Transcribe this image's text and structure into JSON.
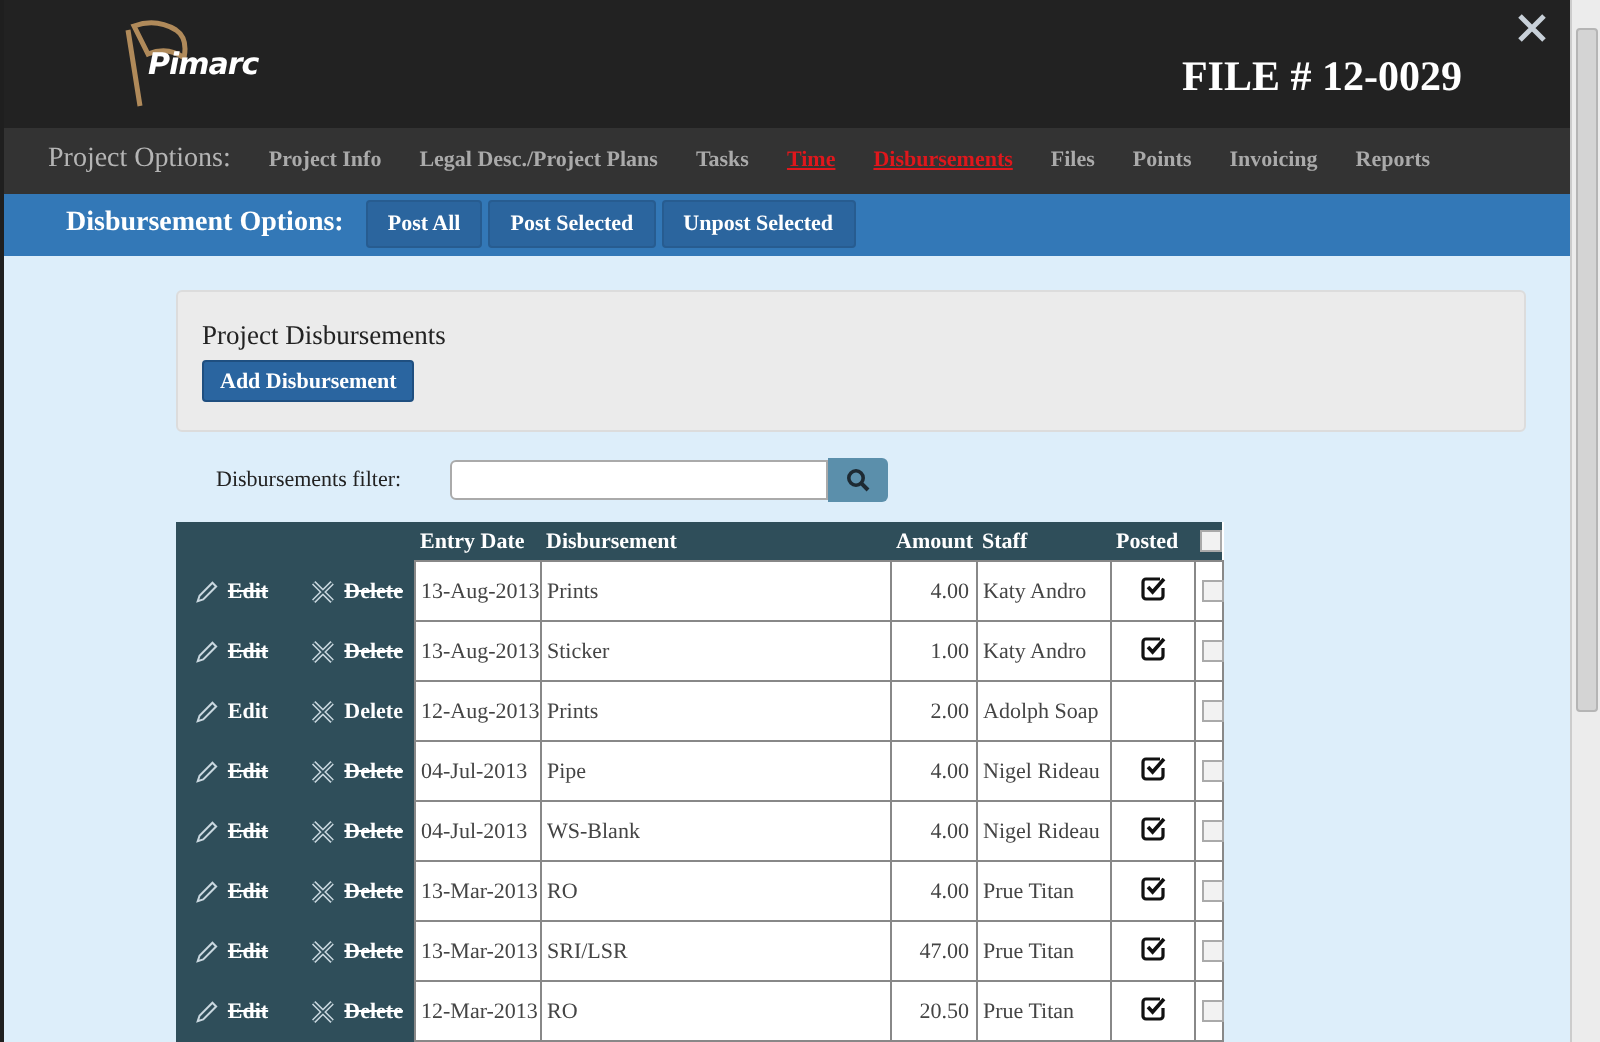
{
  "header": {
    "logo": "Pimarc",
    "file_title": "FILE # 12-0029"
  },
  "project_options": {
    "label": "Project Options:",
    "items": [
      {
        "label": "Project Info",
        "selected": false
      },
      {
        "label": "Legal Desc./Project Plans",
        "selected": false
      },
      {
        "label": "Tasks",
        "selected": false
      },
      {
        "label": "Time",
        "selected": true
      },
      {
        "label": "Disbursements",
        "selected": true
      },
      {
        "label": "Files",
        "selected": false
      },
      {
        "label": "Points",
        "selected": false
      },
      {
        "label": "Invoicing",
        "selected": false
      },
      {
        "label": "Reports",
        "selected": false
      }
    ]
  },
  "disbursement_options": {
    "label": "Disbursement Options:",
    "buttons": [
      "Post All",
      "Post Selected",
      "Unpost Selected"
    ]
  },
  "panel": {
    "title": "Project Disbursements",
    "button": "Add Disbursement"
  },
  "filter": {
    "label": "Disbursements filter:"
  },
  "table": {
    "columns": [
      "Entry Date",
      "Disbursement",
      "Amount",
      "Staff",
      "Posted"
    ],
    "select_all": false,
    "rows": [
      {
        "edit": "Edit",
        "delete": "Delete",
        "date": "13-Aug-2013",
        "item": "Prints",
        "amount": "4.00",
        "staff": "Katy Andro",
        "posted": true,
        "selected": false
      },
      {
        "edit": "Edit",
        "delete": "Delete",
        "date": "13-Aug-2013",
        "item": "Sticker",
        "amount": "1.00",
        "staff": "Katy Andro",
        "posted": true,
        "selected": false
      },
      {
        "edit": "Edit",
        "delete": "Delete",
        "date": "12-Aug-2013",
        "item": "Prints",
        "amount": "2.00",
        "staff": "Adolph Soap",
        "posted": false,
        "selected": false
      },
      {
        "edit": "Edit",
        "delete": "Delete",
        "date": "04-Jul-2013",
        "item": "Pipe",
        "amount": "4.00",
        "staff": "Nigel Rideau",
        "posted": true,
        "selected": false
      },
      {
        "edit": "Edit",
        "delete": "Delete",
        "date": "04-Jul-2013",
        "item": "WS-Blank",
        "amount": "4.00",
        "staff": "Nigel Rideau",
        "posted": true,
        "selected": false
      },
      {
        "edit": "Edit",
        "delete": "Delete",
        "date": "13-Mar-2013",
        "item": "RO",
        "amount": "4.00",
        "staff": "Prue Titan",
        "posted": true,
        "selected": false
      },
      {
        "edit": "Edit",
        "delete": "Delete",
        "date": "13-Mar-2013",
        "item": "SRI/LSR",
        "amount": "47.00",
        "staff": "Prue Titan",
        "posted": true,
        "selected": false
      },
      {
        "edit": "Edit",
        "delete": "Delete",
        "date": "12-Mar-2013",
        "item": "RO",
        "amount": "20.50",
        "staff": "Prue Titan",
        "posted": true,
        "selected": false
      }
    ]
  }
}
